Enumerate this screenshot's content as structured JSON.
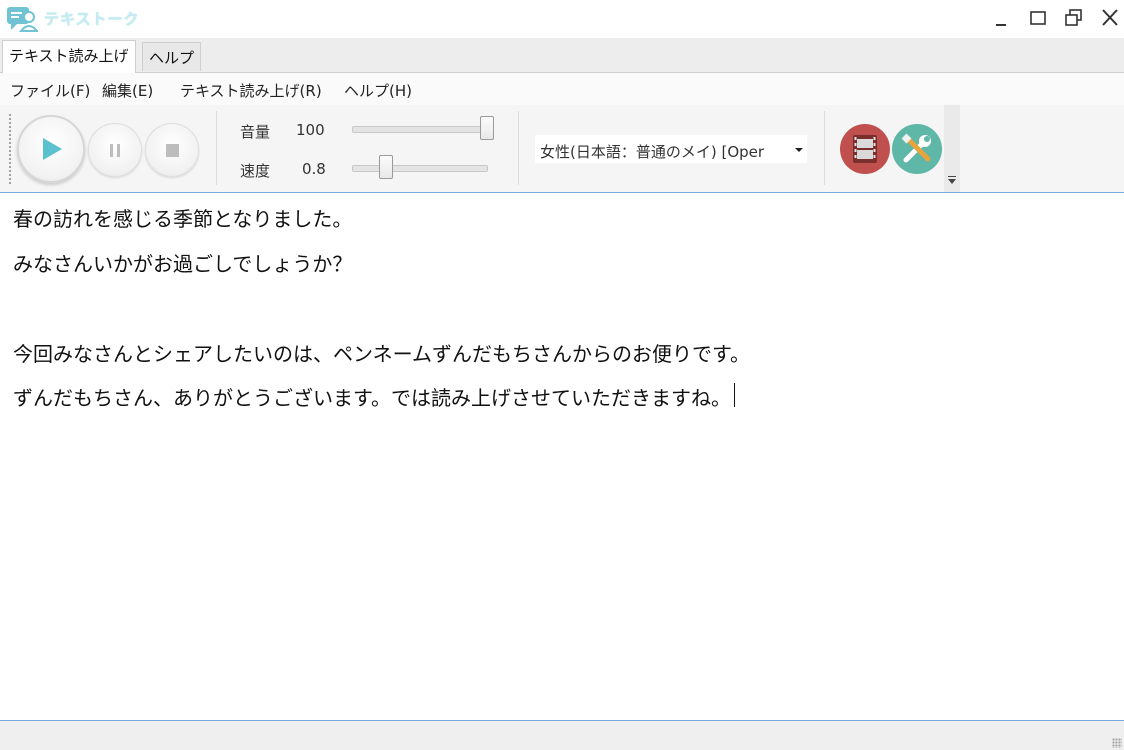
{
  "window": {
    "title": "テキストーク",
    "controls": [
      "minimize-icon",
      "maximize-icon",
      "restore-icon",
      "close-icon"
    ]
  },
  "ribbon_tabs": [
    {
      "label": "テキスト読み上げ",
      "active": true
    },
    {
      "label": "ヘルプ",
      "active": false
    }
  ],
  "menu": [
    {
      "label": "ファイル(F)"
    },
    {
      "label": "編集(E)"
    },
    {
      "label": "テキスト読み上げ(R)"
    },
    {
      "label": "ヘルプ(H)"
    }
  ],
  "toolbar": {
    "volume": {
      "label": "音量",
      "value": "100",
      "level": 1.0
    },
    "speed": {
      "label": "速度",
      "value": "0.8",
      "level": 0.22
    },
    "voice_selected": "女性(日本語：普通のメイ) [Oper",
    "buttons": [
      "play-icon",
      "pause-icon",
      "stop-icon",
      "film-icon",
      "tools-icon"
    ]
  },
  "editor": {
    "lines": [
      "春の訪れを感じる季節となりました。",
      "みなさんいかがお過ごしでしょうか？",
      "",
      "今回みなさんとシェアしたいのは、ペンネームずんだもちさんからのお便りです。",
      "ずんだもちさん、ありがとうございます。では読み上げさせていただきますね。"
    ]
  },
  "colors": {
    "accent_blue": "#78a9de",
    "play_teal": "#5bc1cf",
    "film_red": "#c0504d",
    "tools_teal": "#5fb7a8"
  }
}
